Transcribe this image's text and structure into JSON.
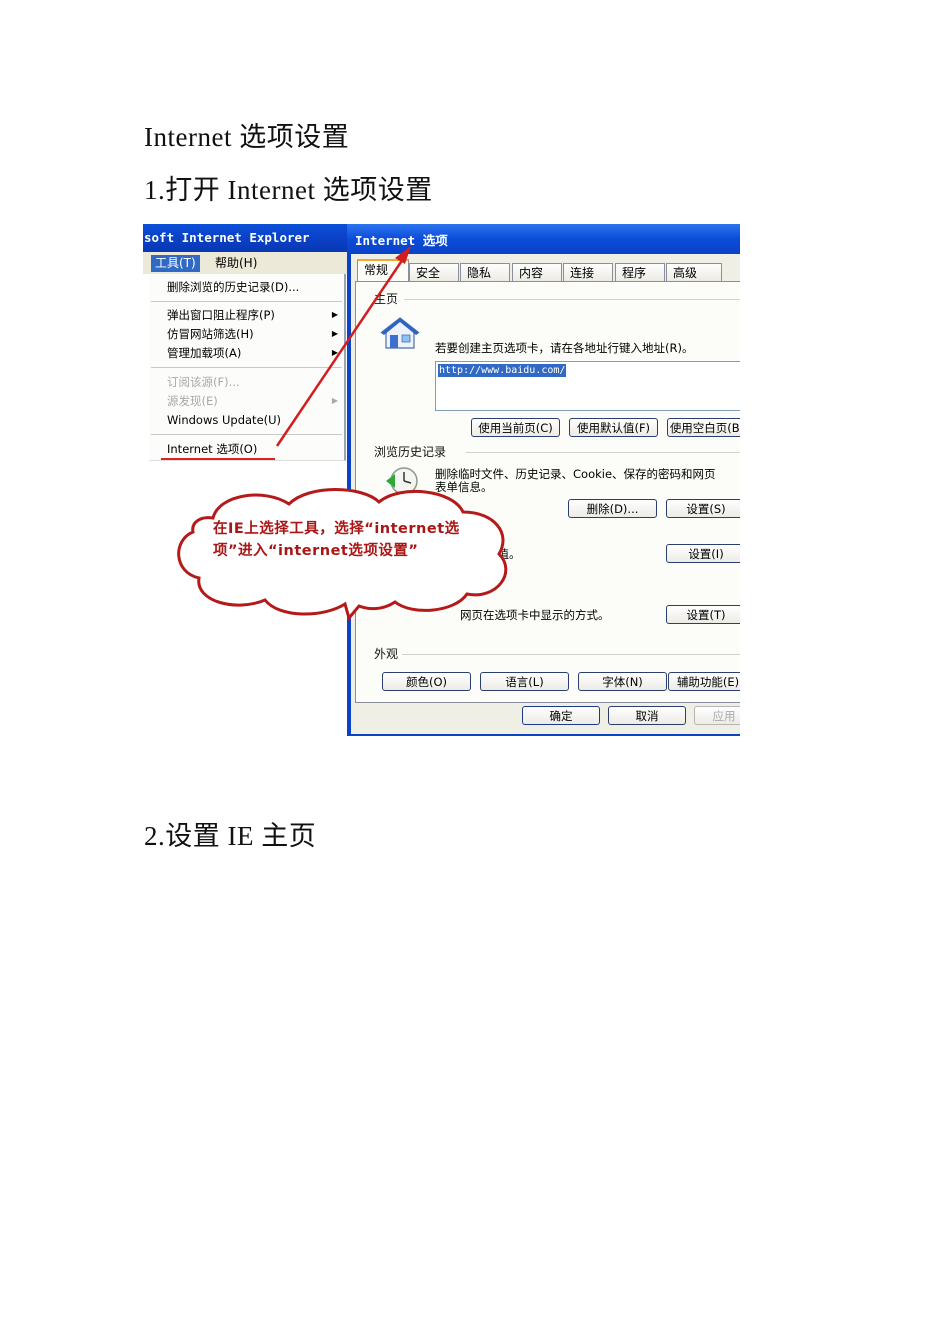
{
  "document": {
    "title": "Internet  选项设置",
    "step1": "1.打开 Internet  选项设置",
    "step2": "2.设置 IE 主页"
  },
  "ie_window": {
    "title": "soft  Internet  Explorer",
    "menubar": {
      "tools": "工具(T)",
      "help": "帮助(H)"
    },
    "menu_items": [
      {
        "label": "删除浏览的历史记录(D)...",
        "enabled": true,
        "submenu": false
      },
      {
        "label": "弹出窗口阻止程序(P)",
        "enabled": true,
        "submenu": true
      },
      {
        "label": "仿冒网站筛选(H)",
        "enabled": true,
        "submenu": true
      },
      {
        "label": "管理加载项(A)",
        "enabled": true,
        "submenu": true
      },
      {
        "label": "订阅该源(F)...",
        "enabled": false,
        "submenu": false
      },
      {
        "label": "源发现(E)",
        "enabled": false,
        "submenu": true
      },
      {
        "label": "Windows Update(U)",
        "enabled": true,
        "submenu": false
      },
      {
        "label": "Internet 选项(O)",
        "enabled": true,
        "submenu": false
      }
    ]
  },
  "options_dialog": {
    "title": "Internet 选项",
    "tabs": [
      "常规",
      "安全",
      "隐私",
      "内容",
      "连接",
      "程序",
      "高级"
    ],
    "active_tab": "常规",
    "home_page": {
      "group": "主页",
      "description": "若要创建主页选项卡，请在各地址行键入地址(R)。",
      "url": "http://www.baidu.com/",
      "buttons": [
        "使用当前页(C)",
        "使用默认值(F)",
        "使用空白页(B)"
      ]
    },
    "history": {
      "group": "浏览历史记录",
      "description_line1": "删除临时文件、历史记录、Cookie、保存的密码和网页",
      "description_line2": "表单信息。",
      "delete_button": "删除(D)...",
      "settings_button": "设置(S)"
    },
    "search": {
      "partial_text": "认值。",
      "settings_button": "设置(I)"
    },
    "tabs_section": {
      "partial_text": "网页在选项卡中显示的方式。",
      "settings_button": "设置(T)"
    },
    "appearance": {
      "group": "外观",
      "buttons": [
        "颜色(O)",
        "语言(L)",
        "字体(N)",
        "辅助功能(E)"
      ]
    },
    "footer_buttons": {
      "ok": "确定",
      "cancel": "取消",
      "apply": "应用"
    }
  },
  "annotation": {
    "text": "在IE上选择工具，选择“internet选项”进入“internet选项设置”",
    "color": "#a91616"
  }
}
